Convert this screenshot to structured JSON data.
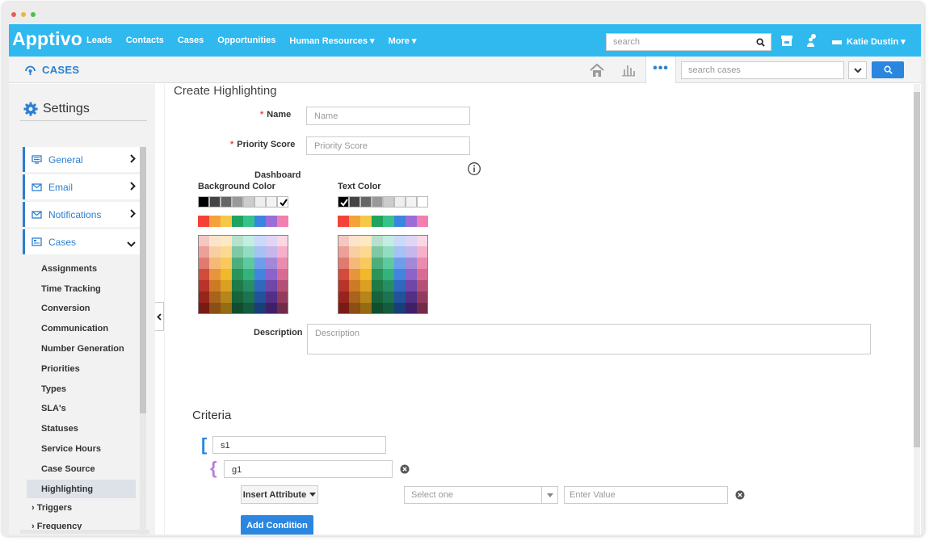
{
  "window": {
    "dot_colors": [
      "#ee5b52",
      "#f0b33a",
      "#4cc04a"
    ]
  },
  "topbar": {
    "logo": "Apptivo",
    "nav": [
      "Leads",
      "Contacts",
      "Cases",
      "Opportunities",
      "Human Resources ▾",
      "More ▾"
    ],
    "search_placeholder": "search",
    "user": "Katie Dustin ▾"
  },
  "subbar": {
    "title": "CASES",
    "more_label": "•••",
    "search_placeholder": "search cases"
  },
  "sidebar": {
    "title": "Settings",
    "menus": [
      {
        "label": "General",
        "icon": "monitor-icon"
      },
      {
        "label": "Email",
        "icon": "envelope-icon"
      },
      {
        "label": "Notifications",
        "icon": "envelope-icon"
      },
      {
        "label": "Cases",
        "icon": "list-icon"
      }
    ],
    "sub_items": [
      "Assignments",
      "Time Tracking",
      "Conversion",
      "Communication",
      "Number Generation",
      "Priorities",
      "Types",
      "SLA's",
      "Statuses",
      "Service Hours",
      "Case Source",
      "Highlighting",
      "› Triggers",
      "› Frequency"
    ],
    "active_sub_item": "Highlighting"
  },
  "form": {
    "heading": "Create Highlighting",
    "name_label": "Name",
    "name_placeholder": "Name",
    "priority_label": "Priority Score",
    "priority_placeholder": "Priority Score",
    "dashboard_label": "Dashboard",
    "bg_color_label": "Background Color",
    "text_color_label": "Text Color",
    "description_label": "Description",
    "description_placeholder": "Description",
    "grays": [
      "#000000",
      "#444444",
      "#666666",
      "#999999",
      "#cccccc",
      "#eeeeee",
      "#f3f3f3",
      "#ffffff"
    ],
    "brights": [
      "#f44336",
      "#f5a23c",
      "#f7c848",
      "#20a35e",
      "#35c38a",
      "#3b84e0",
      "#9a6ed8",
      "#f17fb0"
    ],
    "grid": [
      [
        "#f4c7c3",
        "#fce4cc",
        "#fde9c4",
        "#b7e1cd",
        "#c2ede0",
        "#c9daf8",
        "#e0d5f4",
        "#fbd7e6"
      ],
      [
        "#eca098",
        "#f8cfa3",
        "#fbd991",
        "#80c8a4",
        "#92dcc3",
        "#a4c2f4",
        "#c6b6ec",
        "#f5b0ca"
      ],
      [
        "#e07b72",
        "#f5b877",
        "#f9c95c",
        "#4cae7c",
        "#5cc9a0",
        "#6d9eeb",
        "#a488d8",
        "#ea8caf"
      ],
      [
        "#d24b3b",
        "#e6953c",
        "#f0b82a",
        "#2a9458",
        "#34b27c",
        "#4285e0",
        "#8e63c9",
        "#d96b93"
      ],
      [
        "#b8342a",
        "#cc7b24",
        "#d9a022",
        "#1e7a47",
        "#258f63",
        "#2f68bd",
        "#6e47a8",
        "#b44f76"
      ],
      [
        "#98251d",
        "#a9631b",
        "#b7861a",
        "#17633a",
        "#1d7350",
        "#21529a",
        "#542f87",
        "#933b5e"
      ],
      [
        "#7a1a14",
        "#8a4f14",
        "#956c13",
        "#114e2d",
        "#155b3f",
        "#173f78",
        "#3f2068",
        "#722b48"
      ]
    ],
    "bg_checked": "#ffffff",
    "text_checked": "#000000"
  },
  "criteria": {
    "heading": "Criteria",
    "s1_value": "s1",
    "g1_value": "g1",
    "insert_attribute": "Insert Attribute",
    "select_placeholder": "Select one",
    "value_placeholder": "Enter Value",
    "add_condition": "Add Condition",
    "g1_close": "g1"
  }
}
